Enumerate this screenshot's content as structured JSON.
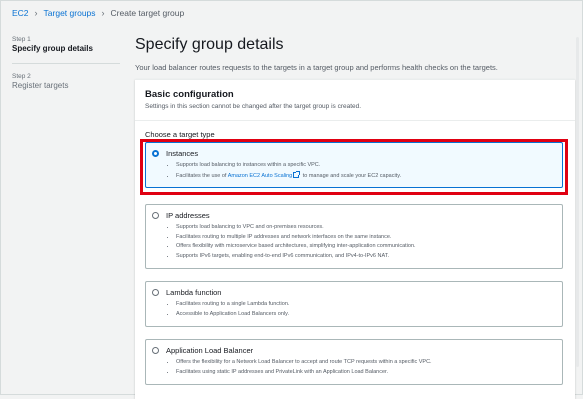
{
  "breadcrumb": {
    "items": [
      "EC2",
      "Target groups"
    ],
    "current": "Create target group"
  },
  "steps": [
    {
      "num": "Step 1",
      "title": "Specify group details"
    },
    {
      "num": "Step 2",
      "title": "Register targets"
    }
  ],
  "main": {
    "title": "Specify group details",
    "description": "Your load balancer routes requests to the targets in a target group and performs health checks on the targets."
  },
  "basic": {
    "title": "Basic configuration",
    "subtitle": "Settings in this section cannot be changed after the target group is created.",
    "type_label": "Choose a target type"
  },
  "target_types": [
    {
      "title": "Instances",
      "selected": true,
      "bullets": [
        "Supports load balancing to instances within a specific VPC.",
        "Facilitates the use of",
        "Amazon EC2 Auto Scaling",
        "to manage and scale your EC2 capacity."
      ]
    },
    {
      "title": "IP addresses",
      "selected": false,
      "bullets": [
        "Supports load balancing to VPC and on-premises resources.",
        "Facilitates routing to multiple IP addresses and network interfaces on the same instance.",
        "Offers flexibility with microservice based architectures, simplifying inter-application communication.",
        "Supports IPv6 targets, enabling end-to-end IPv6 communication, and IPv4-to-IPv6 NAT."
      ]
    },
    {
      "title": "Lambda function",
      "selected": false,
      "bullets": [
        "Facilitates routing to a single Lambda function.",
        "Accessible to Application Load Balancers only."
      ]
    },
    {
      "title": "Application Load Balancer",
      "selected": false,
      "bullets": [
        "Offers the flexibility for a Network Load Balancer to accept and route TCP requests within a specific VPC.",
        "Facilitates using static IP addresses and PrivateLink with an Application Load Balancer."
      ]
    }
  ],
  "colors": {
    "link": "#0972d3",
    "highlight": "#e00012",
    "selected_bg": "#f1faff"
  }
}
